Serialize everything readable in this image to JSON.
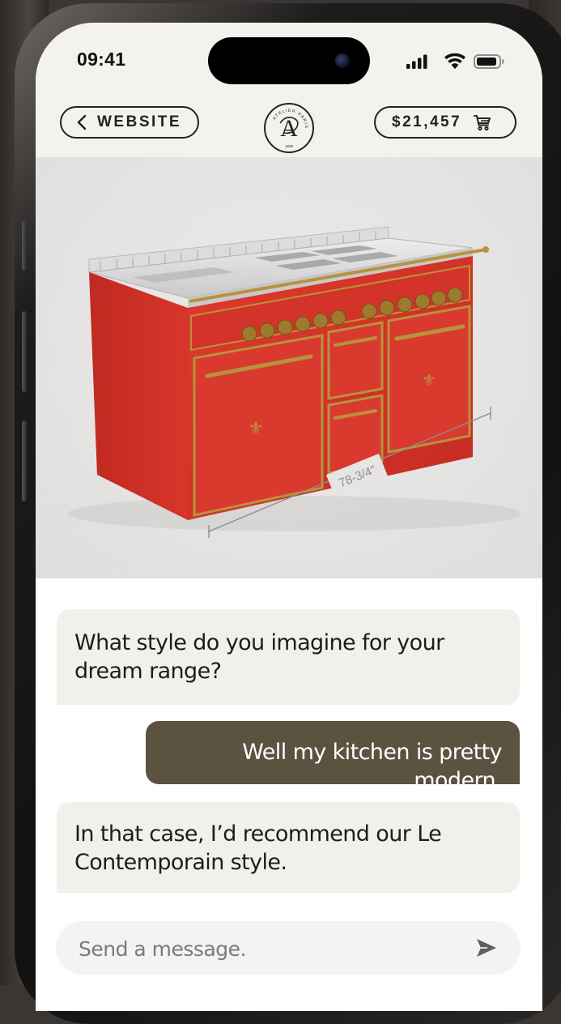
{
  "status_bar": {
    "time": "09:41"
  },
  "header": {
    "back_label": "WEBSITE",
    "cart_total": "$21,457",
    "logo_ring_text": "ATELIER PARIS",
    "logo_year": "1830",
    "logo_letters": "A"
  },
  "product": {
    "dimension_label": "78-3/4\"",
    "colors": {
      "enamel": "#d9352a",
      "brass": "#b8923f",
      "steel": "#d8d8d8"
    }
  },
  "chat": {
    "messages": [
      {
        "role": "assistant",
        "text": "What style do you imagine for your dream range?"
      },
      {
        "role": "user",
        "text": "Well my kitchen is pretty modern."
      },
      {
        "role": "assistant",
        "text": "In that case, I’d recommend our Le Contemporain style."
      }
    ],
    "input_placeholder": "Send a message."
  },
  "colors": {
    "user_bubble": "#5b5240",
    "assistant_bubble": "#f2f0eb",
    "header_bg": "#f4f2ee"
  },
  "icons": {
    "back": "chevron-left-icon",
    "cart": "cart-icon",
    "send": "send-icon",
    "signal": "signal-icon",
    "wifi": "wifi-icon",
    "battery": "battery-icon"
  }
}
